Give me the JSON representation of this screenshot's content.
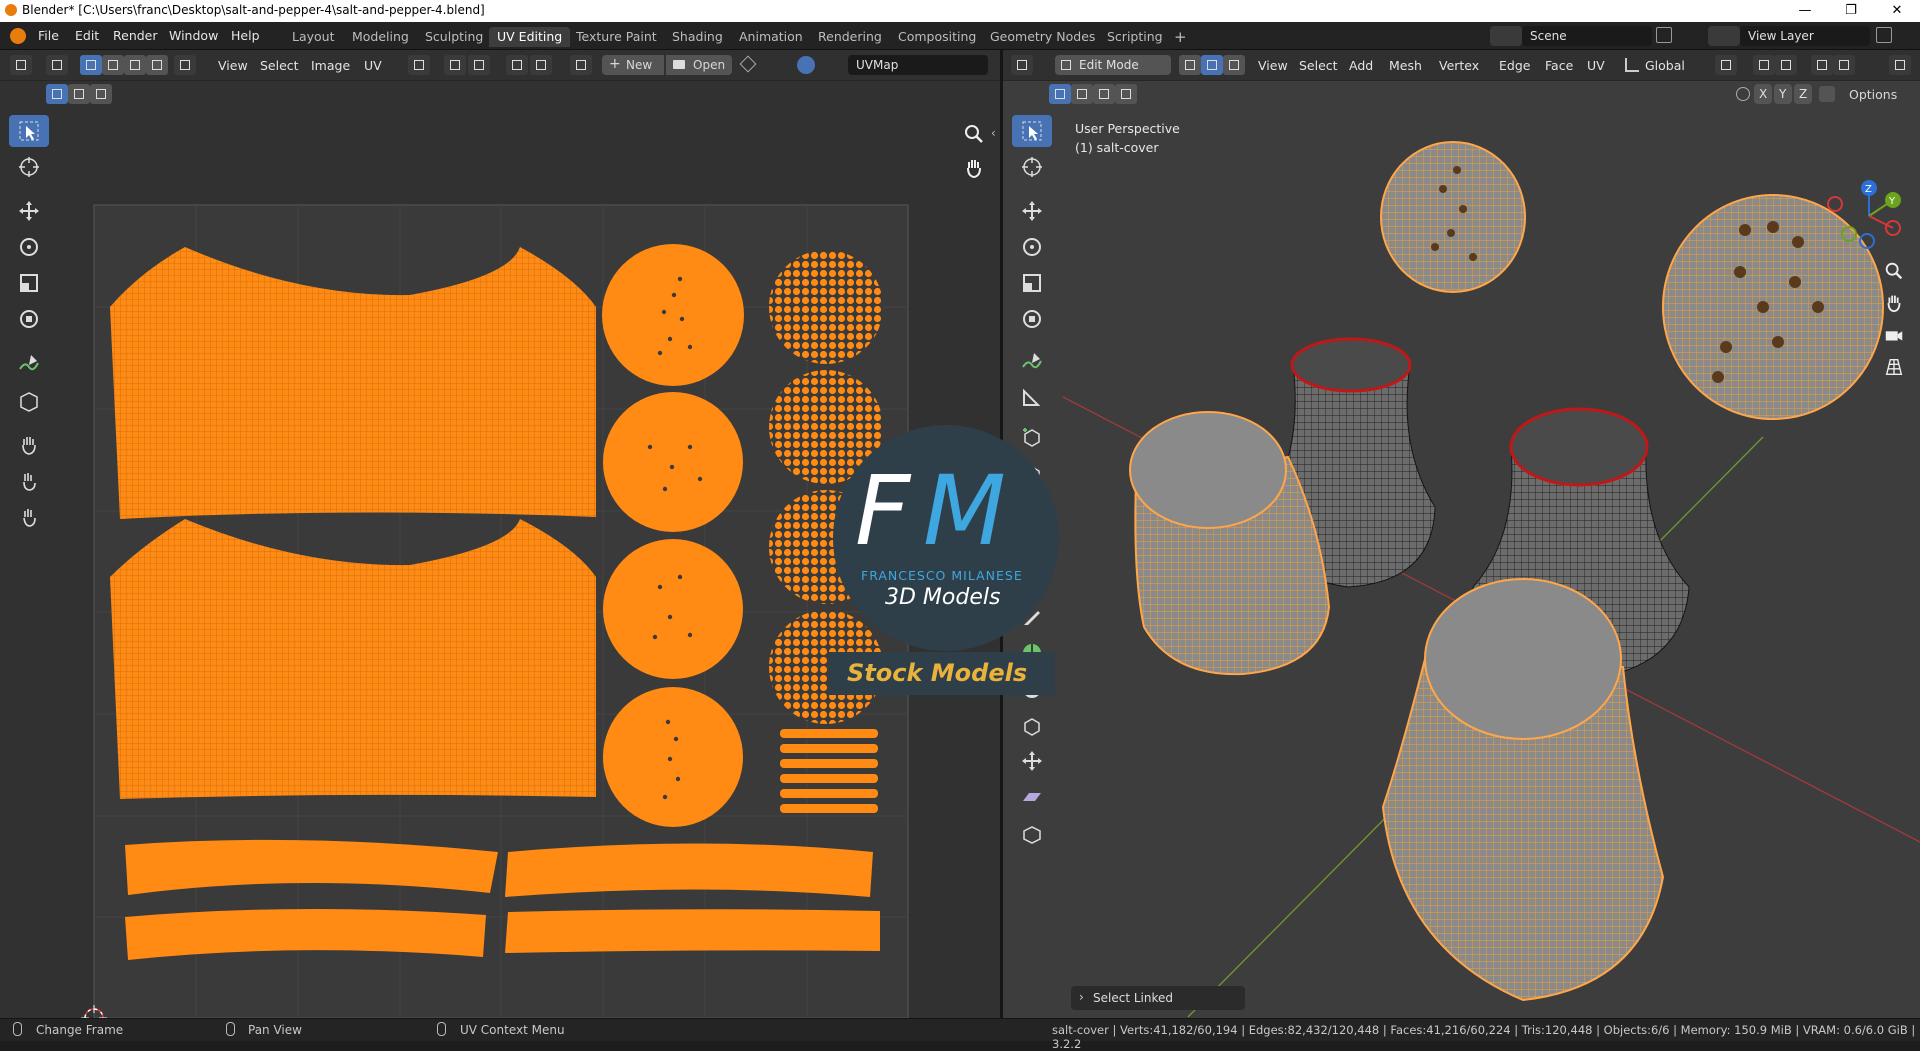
{
  "window": {
    "title": "Blender* [C:\\Users\\franc\\Desktop\\salt-and-pepper-4\\salt-and-pepper-4.blend]",
    "min": "—",
    "max": "❐",
    "close": "✕"
  },
  "menu": [
    "File",
    "Edit",
    "Render",
    "Window",
    "Help"
  ],
  "workspaces": [
    "Layout",
    "Modeling",
    "Sculpting",
    "UV Editing",
    "Texture Paint",
    "Shading",
    "Animation",
    "Rendering",
    "Compositing",
    "Geometry Nodes",
    "Scripting"
  ],
  "workspace_add": "+",
  "scene": {
    "value": "Scene"
  },
  "view_layer": {
    "value": "View Layer"
  },
  "uv": {
    "menus": [
      "View",
      "Select",
      "Image",
      "UV"
    ],
    "new_label": "New",
    "open_label": "Open",
    "uvmap": "UVMap"
  },
  "viewport": {
    "mode": "Edit Mode",
    "menus": [
      "View",
      "Select",
      "Add",
      "Mesh",
      "Vertex",
      "Edge",
      "Face",
      "UV"
    ],
    "orientation": "Global",
    "options": "Options",
    "axes": [
      "X",
      "Y",
      "Z"
    ],
    "perspective": "User Perspective",
    "object": "(1) salt-cover",
    "last_op": "Select Linked",
    "gizmo": {
      "z": "Z",
      "y": "Y"
    }
  },
  "logo": {
    "initials_f": "F",
    "initials_m": "M",
    "name": "FRANCESCO MILANESE",
    "tagline": "3D Models",
    "band": "Stock Models"
  },
  "status": {
    "left": "Change Frame",
    "middle": "Pan View",
    "right": "UV Context Menu",
    "stats": "salt-cover | Verts:41,182/60,194 | Edges:82,432/120,448 | Faces:41,216/60,224 | Tris:120,448 | Objects:6/6 | Memory: 150.9 MiB | VRAM: 0.6/6.0 GiB | 3.2.2"
  },
  "colors": {
    "accent": "#4772b3",
    "uv_orange": "#ff8a14",
    "selected_wire": "#f0a030",
    "seam": "#d01818"
  }
}
